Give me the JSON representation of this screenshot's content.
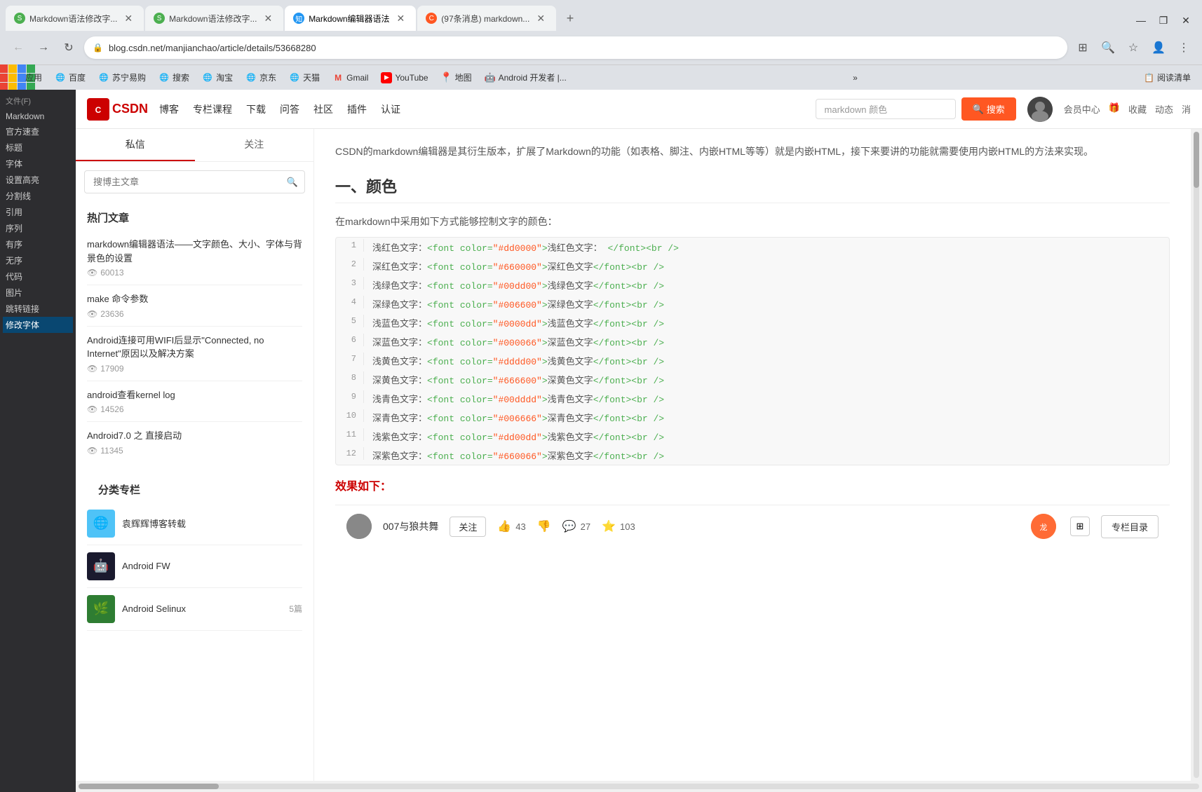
{
  "browser": {
    "tabs": [
      {
        "id": "tab1",
        "title": "Markdown语法修改字...",
        "icon": "S",
        "icon_color": "green",
        "active": false
      },
      {
        "id": "tab2",
        "title": "Markdown语法修改字...",
        "icon": "S",
        "icon_color": "green",
        "active": false
      },
      {
        "id": "tab3",
        "title": "Markdown编辑器语法",
        "icon": "知",
        "icon_color": "blue",
        "active": true
      },
      {
        "id": "tab4",
        "title": "(97条消息) markdown...",
        "icon": "C",
        "icon_color": "orange",
        "active": false
      }
    ],
    "address": "blog.csdn.net/manjianchao/article/details/53668280",
    "new_tab_label": "+",
    "win_minimize": "—",
    "win_restore": "❐",
    "win_close": "✕"
  },
  "bookmarks": [
    {
      "id": "apps",
      "label": "应用",
      "icon": "grid"
    },
    {
      "id": "baidu",
      "label": "百度",
      "icon": "🌐"
    },
    {
      "id": "suning",
      "label": "苏宁易购",
      "icon": "🌐"
    },
    {
      "id": "search",
      "label": "搜索",
      "icon": "🌐"
    },
    {
      "id": "taobao",
      "label": "淘宝",
      "icon": "🌐"
    },
    {
      "id": "jd",
      "label": "京东",
      "icon": "🌐"
    },
    {
      "id": "tianmao",
      "label": "天猫",
      "icon": "🌐"
    },
    {
      "id": "gmail",
      "label": "Gmail",
      "icon": "G"
    },
    {
      "id": "youtube",
      "label": "YouTube",
      "icon": "YT"
    },
    {
      "id": "map",
      "label": "地图",
      "icon": "📍"
    },
    {
      "id": "android",
      "label": "Android 开发者 |...",
      "icon": "🤖"
    }
  ],
  "read_list_label": "阅读清单",
  "csdn": {
    "logo_text": "CSDN",
    "nav_items": [
      "博客",
      "专栏课程",
      "下载",
      "问答",
      "社区",
      "插件",
      "认证"
    ],
    "search_placeholder": "markdown 颜色",
    "search_button": "搜索",
    "header_links": [
      "会员中心",
      "🎁",
      "收藏",
      "动态",
      "消"
    ]
  },
  "sidebar": {
    "tabs": [
      "私信",
      "关注"
    ],
    "search_placeholder": "搜博主文章",
    "hot_articles_title": "热门文章",
    "articles": [
      {
        "title": "markdown编辑器语法——文字颜色、大小、字体与背景色的设置",
        "views": "60013"
      },
      {
        "title": "make 命令参数",
        "views": "23636"
      },
      {
        "title": "Android连接可用WIFI后显示\"Connected, no Internet\"原因以及解决方案",
        "views": "17909"
      },
      {
        "title": "android查看kernel log",
        "views": "14526"
      },
      {
        "title": "Android7.0 之 直接启动",
        "views": "11345"
      }
    ],
    "category_title": "分类专栏",
    "categories": [
      {
        "name": "袁辉辉博客转载",
        "icon": "🌐",
        "bg": "#4fc3f7",
        "count": ""
      },
      {
        "name": "Android FW",
        "icon": "🤖",
        "bg": "#1a1a2e",
        "count": ""
      },
      {
        "name": "Android Selinux",
        "icon": "🌿",
        "bg": "#2e7d32",
        "count": "5篇"
      }
    ]
  },
  "article": {
    "intro": "CSDN的markdown编辑器是其衍生版本，扩展了Markdown的功能（如表格、脚注、内嵌HTML等等）就是内嵌HTML，接下来要讲的功能就需要使用内嵌HTML的方法来实现。",
    "section1_title": "一、颜色",
    "color_intro": "在markdown中采用如下方式能够控制文字的颜色：",
    "code_lines": [
      {
        "num": "1",
        "prefix": "浅红色文字：",
        "code": "<font color=\"#dd0000\">浅红色文字：</font><br />"
      },
      {
        "num": "2",
        "prefix": "深红色文字：",
        "code": "<font color=\"#660000\">深红色文字</font><br />"
      },
      {
        "num": "3",
        "prefix": "浅绿色文字：",
        "code": "<font color=\"#00dd00\">浅绿色文字</font><br />"
      },
      {
        "num": "4",
        "prefix": "深绿色文字：",
        "code": "<font color=\"#006600\">深绿色文字</font><br />"
      },
      {
        "num": "5",
        "prefix": "浅蓝色文字：",
        "code": "<font color=\"#0000dd\">浅蓝色文字</font><br />"
      },
      {
        "num": "6",
        "prefix": "深蓝色文字：",
        "code": "<font color=\"#000066\">深蓝色文字</font><br />"
      },
      {
        "num": "7",
        "prefix": "浅黄色文字：",
        "code": "<font color=\"#dddd00\">浅黄色文字</font><br />"
      },
      {
        "num": "8",
        "prefix": "深黄色文字：",
        "code": "<font color=\"#666600\">深黄色文字</font><br />"
      },
      {
        "num": "9",
        "prefix": "浅青色文字：",
        "code": "<font color=\"#00dddd\">浅青色文字</font><br />"
      },
      {
        "num": "10",
        "prefix": "深青色文字：",
        "code": "<font color=\"#006666\">深青色文字</font><br />"
      },
      {
        "num": "11",
        "prefix": "浅紫色文字：",
        "code": "<font color=\"#dd00dd\">浅紫色文字</font><br />"
      },
      {
        "num": "12",
        "prefix": "深紫色文字：",
        "code": "<font color=\"#660066\">深紫色文字</font><br />"
      }
    ],
    "result_label": "效果如下：",
    "author_name": "007与狼共舞",
    "follow_btn": "关注",
    "likes": "43",
    "dislikes": "",
    "comments": "27",
    "stars": "103",
    "toc_btn": "专栏目录"
  },
  "file_sidebar": {
    "title": "文件(F)",
    "items": [
      "Markdown",
      "官方速查",
      "标题",
      "字体",
      "设置高亮",
      "分割线",
      "引用",
      "序列",
      "有序",
      "无序",
      "代码",
      "图片",
      "跳转链接",
      "修改字体"
    ]
  }
}
